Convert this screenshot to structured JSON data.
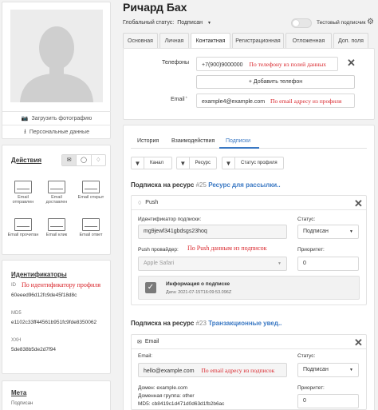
{
  "profile": {
    "upload_photo": "Загрузить фотографию",
    "personal_data": "Персональные данные"
  },
  "actions": {
    "title": "Действия",
    "items": [
      "Email отправлен",
      "Email доставлен",
      "Email открыт",
      "Email прочитан",
      "Email клик",
      "Email ответ"
    ]
  },
  "identifiers": {
    "title": "Идентификаторы",
    "id_label": "ID",
    "id_note": "По идентификатору профиля",
    "id_value": "60eeed96d12fc9de45f18d8c",
    "md5_label": "MD5",
    "md5_value": "e1102c33ff44561b951fc9fde8350062",
    "xxh_label": "XXH",
    "xxh_value": "5de838b5de2d7f94"
  },
  "meta": {
    "title": "Мета",
    "subtitle": "Подписан"
  },
  "header": {
    "name": "Ричард Бах",
    "status_label": "Глобальный статус:",
    "status_value": "Подписан",
    "test_subscriber": "Тестовый подписчик"
  },
  "tabs": [
    "Основная",
    "Личная",
    "Контактная",
    "Регистрационная",
    "Отложенная",
    "Доп. поля"
  ],
  "contacts": {
    "phones_label": "Телефоны",
    "phone_value": "+7(900)9000000",
    "phone_note": "По телефону из полей данных",
    "add_phone": "+ Добавить телефон",
    "email_label": "Email",
    "email_required": "*",
    "email_value": "example4@example.com",
    "email_note": "По email адресу из профиля"
  },
  "subtabs": [
    "История",
    "Взаимодействия",
    "Подписки"
  ],
  "filters": [
    "Канал",
    "Ресурс",
    "Статус профиля"
  ],
  "sub1": {
    "title_prefix": "Подписка на ресурс",
    "num": "#25",
    "resource": "Ресурс для рассылки..",
    "channel": "Push",
    "id_label": "Идентификатор подписки:",
    "id_value": "mg9jewf341gbdsgs23hoq",
    "provider_label": "Push провайдер:",
    "provider_note": "По Push данным из подписок",
    "provider_value": "Apple Safari",
    "status_label": "Статус:",
    "status_value": "Подписан",
    "priority_label": "Приоритет:",
    "priority_value": "0",
    "info_title": "Информация о подписке",
    "info_date": "Дата: 2021-07-15T16:09:53.096Z"
  },
  "sub2": {
    "title_prefix": "Подписка на ресурс",
    "num": "#23",
    "resource": "Транзакционные увед..",
    "channel": "Email",
    "email_label": "Email:",
    "email_value": "hello@example.com",
    "email_note": "По email адресу из подписок",
    "status_label": "Статус:",
    "status_value": "Подписан",
    "priority_label": "Приоритет:",
    "priority_value": "0",
    "domain": "Домен: example.com",
    "domain_group": "Доменная группа: other",
    "md5": "MD5: cb8419c1d471d0d63d1fb2b6ac"
  }
}
